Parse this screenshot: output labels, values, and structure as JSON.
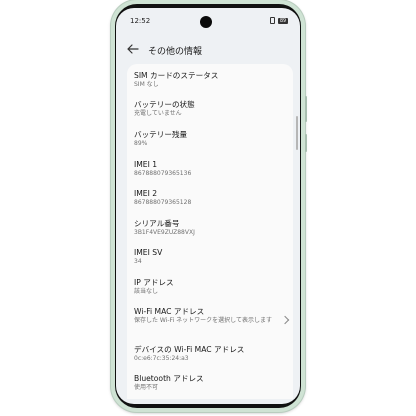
{
  "status_bar": {
    "time": "12:52",
    "battery": "89"
  },
  "app_bar": {
    "title": "その他の情報"
  },
  "items": [
    {
      "label": "SIM カードのステータス",
      "value": "SIM なし"
    },
    {
      "label": "バッテリーの状態",
      "value": "充電していません"
    },
    {
      "label": "バッテリー残量",
      "value": "89%"
    },
    {
      "label": "IMEI 1",
      "value": "867888079365136"
    },
    {
      "label": "IMEI 2",
      "value": "867888079365128"
    },
    {
      "label": "シリアル番号",
      "value": "3B1F4VE9ZUZ88VXJ"
    },
    {
      "label": "IMEI SV",
      "value": "34"
    },
    {
      "label": "IP アドレス",
      "value": "該当なし"
    },
    {
      "label": "Wi-Fi MAC アドレス",
      "value": "保存した Wi-Fi ネットワークを選択して表示します"
    },
    {
      "label": "デバイスの Wi-Fi MAC アドレス",
      "value": "0c:e6:7c:35:24:a3"
    },
    {
      "label": "Bluetooth アドレス",
      "value": "使用不可"
    }
  ],
  "colors": {
    "phone_frame": "#cfe3d4",
    "screen_bg": "#eef1f4",
    "card_bg": "#fafafa"
  }
}
